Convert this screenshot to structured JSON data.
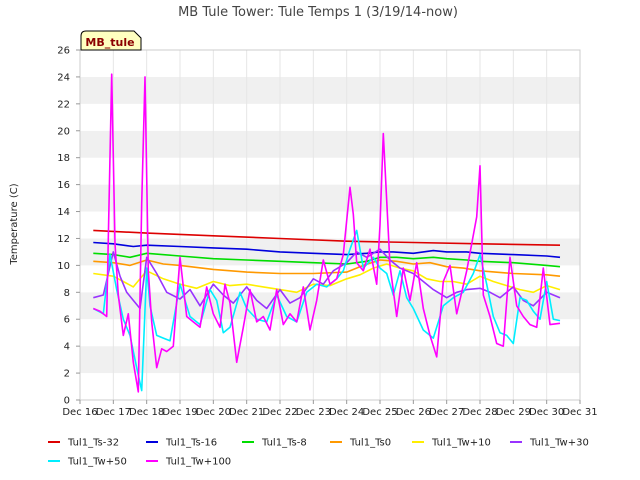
{
  "chart_data": {
    "type": "line",
    "title": "MB Tule Tower: Tule Temps 1 (3/19/14-now)",
    "badge": "MB_tule",
    "xlabel": "",
    "ylabel": "Temperature (C)",
    "xlim": [
      16,
      31
    ],
    "ylim": [
      0,
      26
    ],
    "x_ticks": [
      16,
      17,
      18,
      19,
      20,
      21,
      22,
      23,
      24,
      25,
      26,
      27,
      28,
      29,
      30,
      31
    ],
    "x_tick_labels": [
      "Dec 16",
      "Dec 17",
      "Dec 18",
      "Dec 19",
      "Dec 20",
      "Dec 21",
      "Dec 22",
      "Dec 23",
      "Dec 24",
      "Dec 25",
      "Dec 26",
      "Dec 27",
      "Dec 28",
      "Dec 29",
      "Dec 30",
      "Dec 31"
    ],
    "y_ticks": [
      0,
      2,
      4,
      6,
      8,
      10,
      12,
      14,
      16,
      18,
      20,
      22,
      24,
      26
    ],
    "grid": "horizontal alternating bands",
    "legend_position": "bottom",
    "series": [
      {
        "name": "Tul1_Ts-32",
        "color": "#dd0000",
        "x": [
          16.4,
          18,
          20,
          22,
          24,
          26,
          28,
          30.4
        ],
        "y": [
          12.6,
          12.4,
          12.2,
          12.0,
          11.8,
          11.7,
          11.6,
          11.5
        ]
      },
      {
        "name": "Tul1_Ts-16",
        "color": "#0000dd",
        "x": [
          16.4,
          17,
          17.6,
          18,
          19,
          20,
          21,
          22,
          23,
          24,
          24.6,
          25,
          25.4,
          26,
          26.6,
          27,
          27.6,
          28,
          29,
          30,
          30.4
        ],
        "y": [
          11.7,
          11.6,
          11.4,
          11.5,
          11.4,
          11.3,
          11.2,
          11.0,
          10.9,
          10.8,
          10.9,
          11.0,
          11.0,
          10.9,
          11.1,
          11.0,
          11.0,
          10.9,
          10.8,
          10.7,
          10.6
        ]
      },
      {
        "name": "Tul1_Ts-8",
        "color": "#00dd00",
        "x": [
          16.4,
          17,
          17.5,
          18,
          19,
          20,
          21,
          22,
          23,
          24,
          24.6,
          25,
          25.5,
          26,
          26.6,
          27,
          27.6,
          28,
          29,
          30,
          30.4
        ],
        "y": [
          10.9,
          10.8,
          10.6,
          10.9,
          10.7,
          10.5,
          10.4,
          10.3,
          10.2,
          10.1,
          10.3,
          10.6,
          10.6,
          10.5,
          10.6,
          10.5,
          10.4,
          10.3,
          10.2,
          10.0,
          9.9
        ]
      },
      {
        "name": "Tul1_Ts0",
        "color": "#ff9900",
        "x": [
          16.4,
          17,
          17.5,
          18,
          18.5,
          19,
          20,
          21,
          22,
          23,
          24,
          24.5,
          25,
          25.5,
          26,
          26.5,
          27,
          27.5,
          28,
          29,
          30,
          30.4
        ],
        "y": [
          10.3,
          10.2,
          10.0,
          10.4,
          10.1,
          10.0,
          9.7,
          9.5,
          9.4,
          9.4,
          9.5,
          10.0,
          10.4,
          10.3,
          10.1,
          10.2,
          9.9,
          9.8,
          9.6,
          9.4,
          9.3,
          9.2
        ]
      },
      {
        "name": "Tul1_Tw+10",
        "color": "#ffee00",
        "x": [
          16.4,
          17,
          17.3,
          17.6,
          18,
          18.5,
          19,
          19.5,
          20,
          20.5,
          21,
          21.5,
          22,
          22.5,
          23,
          23.5,
          24,
          24.4,
          24.8,
          25.2,
          25.6,
          26,
          26.4,
          26.8,
          27.2,
          27.6,
          28,
          28.4,
          28.8,
          29.2,
          29.6,
          30,
          30.4
        ],
        "y": [
          9.4,
          9.2,
          8.8,
          8.4,
          9.6,
          9.0,
          8.6,
          8.3,
          8.8,
          8.5,
          8.6,
          8.4,
          8.2,
          8.0,
          8.6,
          8.5,
          9.0,
          9.3,
          9.8,
          10.1,
          9.8,
          9.6,
          9.0,
          8.8,
          8.8,
          8.6,
          9.2,
          8.8,
          8.5,
          8.2,
          8.0,
          8.5,
          8.2
        ]
      },
      {
        "name": "Tul1_Tw+30",
        "color": "#9933ff",
        "x": [
          16.4,
          16.7,
          17,
          17.2,
          17.4,
          17.6,
          17.8,
          18,
          18.3,
          18.6,
          19,
          19.3,
          19.6,
          20,
          20.3,
          20.6,
          21,
          21.3,
          21.6,
          22,
          22.3,
          22.6,
          23,
          23.3,
          23.6,
          24,
          24.3,
          24.6,
          25,
          25.3,
          25.6,
          26,
          26.3,
          26.6,
          27,
          27.3,
          27.6,
          28,
          28.3,
          28.6,
          29,
          29.3,
          29.6,
          30,
          30.4
        ],
        "y": [
          7.6,
          7.8,
          11.0,
          9.2,
          8.0,
          7.4,
          6.8,
          10.6,
          9.4,
          8.0,
          7.5,
          8.2,
          7.0,
          8.6,
          7.8,
          7.2,
          8.4,
          7.4,
          6.8,
          8.2,
          7.2,
          7.6,
          9.0,
          8.6,
          9.6,
          10.2,
          11.0,
          10.6,
          11.2,
          10.4,
          9.8,
          9.4,
          8.8,
          8.2,
          7.6,
          8.0,
          8.2,
          8.3,
          8.0,
          7.6,
          8.4,
          7.4,
          7.0,
          8.0,
          7.6
        ]
      },
      {
        "name": "Tul1_Tw+50",
        "color": "#00eeff",
        "x": [
          16.4,
          16.7,
          16.9,
          17.1,
          17.3,
          17.5,
          17.7,
          17.85,
          18.0,
          18.1,
          18.3,
          18.5,
          18.7,
          19.0,
          19.3,
          19.6,
          19.9,
          20.1,
          20.3,
          20.5,
          20.8,
          21.0,
          21.3,
          21.6,
          21.9,
          22.2,
          22.5,
          22.8,
          23.1,
          23.4,
          23.7,
          23.9,
          24.1,
          24.3,
          24.5,
          24.8,
          25.0,
          25.2,
          25.4,
          25.6,
          25.8,
          26.0,
          26.3,
          26.6,
          26.9,
          27.2,
          27.5,
          27.8,
          28.0,
          28.2,
          28.4,
          28.6,
          28.8,
          29.0,
          29.2,
          29.4,
          29.6,
          29.8,
          30.0,
          30.2,
          30.4
        ],
        "y": [
          6.8,
          6.4,
          10.8,
          8.2,
          6.0,
          4.8,
          2.4,
          0.7,
          9.8,
          7.0,
          4.8,
          4.6,
          4.4,
          8.6,
          6.2,
          5.6,
          8.2,
          7.4,
          5.0,
          5.4,
          8.0,
          6.8,
          6.0,
          5.8,
          7.8,
          6.2,
          5.8,
          8.0,
          8.6,
          8.4,
          9.0,
          9.6,
          11.2,
          12.6,
          9.8,
          10.6,
          9.8,
          9.4,
          7.8,
          9.6,
          7.6,
          6.8,
          5.2,
          4.6,
          7.0,
          7.6,
          8.0,
          9.4,
          10.8,
          8.6,
          6.2,
          5.0,
          4.8,
          4.2,
          7.6,
          7.4,
          6.6,
          6.0,
          8.8,
          6.0,
          5.9
        ]
      },
      {
        "name": "Tul1_Tw+100",
        "color": "#ff00ff",
        "x": [
          16.4,
          16.6,
          16.8,
          16.95,
          17.05,
          17.15,
          17.3,
          17.45,
          17.6,
          17.75,
          17.85,
          17.95,
          18.05,
          18.15,
          18.3,
          18.45,
          18.6,
          18.8,
          19.0,
          19.2,
          19.4,
          19.6,
          19.8,
          20.0,
          20.2,
          20.35,
          20.5,
          20.7,
          20.9,
          21.1,
          21.3,
          21.5,
          21.7,
          21.9,
          22.1,
          22.3,
          22.5,
          22.7,
          22.9,
          23.1,
          23.3,
          23.5,
          23.7,
          23.9,
          24.1,
          24.2,
          24.3,
          24.5,
          24.7,
          24.9,
          25.0,
          25.1,
          25.3,
          25.5,
          25.7,
          25.9,
          26.1,
          26.3,
          26.5,
          26.7,
          26.9,
          27.1,
          27.3,
          27.6,
          27.9,
          28.0,
          28.1,
          28.3,
          28.5,
          28.7,
          28.9,
          29.1,
          29.3,
          29.5,
          29.7,
          29.9,
          30.1,
          30.4
        ],
        "y": [
          6.8,
          6.6,
          6.2,
          24.2,
          11.6,
          7.8,
          4.8,
          6.4,
          2.8,
          0.6,
          14.6,
          24.0,
          9.6,
          5.8,
          2.4,
          3.8,
          3.6,
          4.0,
          10.6,
          6.2,
          5.8,
          5.4,
          8.4,
          6.4,
          5.4,
          8.6,
          7.2,
          2.8,
          5.4,
          8.2,
          5.8,
          6.2,
          5.2,
          8.2,
          5.6,
          6.4,
          5.8,
          8.4,
          5.2,
          7.4,
          10.4,
          8.6,
          9.0,
          10.8,
          15.8,
          13.8,
          10.2,
          9.6,
          11.2,
          8.6,
          13.0,
          19.8,
          10.0,
          6.2,
          9.8,
          7.4,
          10.2,
          6.8,
          4.8,
          3.2,
          8.8,
          10.0,
          6.4,
          9.6,
          13.6,
          17.4,
          7.8,
          6.2,
          4.2,
          4.0,
          10.6,
          7.0,
          6.2,
          5.6,
          5.4,
          9.8,
          5.6,
          5.7
        ]
      }
    ]
  }
}
